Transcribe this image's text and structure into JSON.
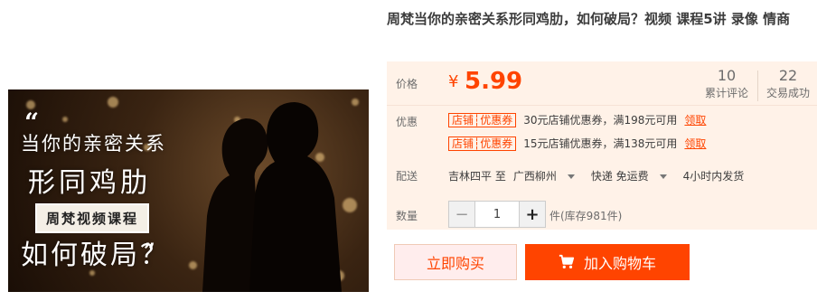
{
  "product": {
    "title": "周梵当你的亲密关系形同鸡肋，如何破局？视频 课程5讲 录像 情商"
  },
  "image": {
    "quote_open": "“",
    "line1": "当你的亲密关系",
    "line2": "形同鸡肋",
    "tag": "周梵视频课程",
    "line4": "如何破局？",
    "quote_close": "”"
  },
  "price": {
    "label": "价格",
    "currency": "¥",
    "value": "5.99"
  },
  "stats": {
    "reviews_count": "10",
    "reviews_label": "累计评论",
    "sales_count": "22",
    "sales_label": "交易成功"
  },
  "promo": {
    "label": "优惠",
    "coupons": [
      {
        "badge": "店铺┆优惠券",
        "text": "30元店铺优惠券，满198元可用",
        "link": "领取"
      },
      {
        "badge": "店铺┆优惠券",
        "text": "15元店铺优惠券，满138元可用",
        "link": "领取"
      }
    ]
  },
  "delivery": {
    "label": "配送",
    "from": "吉林四平 至",
    "to": "广西柳州",
    "shipping": "快递 免运费",
    "dispatch": "4小时内发货"
  },
  "quantity": {
    "label": "数量",
    "minus": "−",
    "value": "1",
    "plus": "+",
    "stock": "件(库存981件)"
  },
  "actions": {
    "buy_now": "立即购买",
    "add_to_cart": "加入购物车"
  },
  "colors": {
    "accent": "#ff4400",
    "price_bg": "#fff2e8"
  },
  "icons": {
    "cart": "shopping-cart-icon",
    "caret": "chevron-down-icon"
  }
}
